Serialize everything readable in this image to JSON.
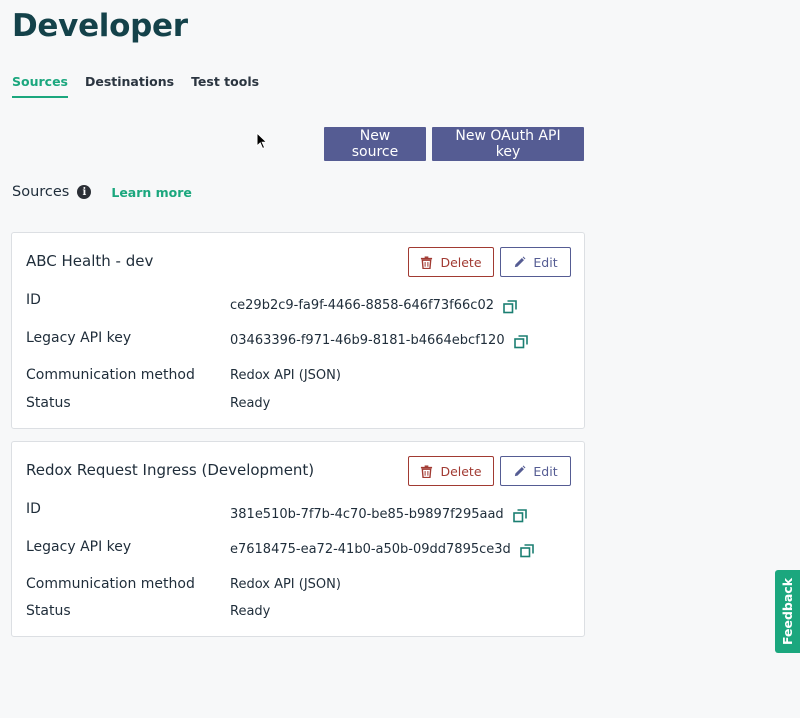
{
  "page": {
    "title": "Developer"
  },
  "tabs": [
    {
      "label": "Sources",
      "active": true
    },
    {
      "label": "Destinations",
      "active": false
    },
    {
      "label": "Test tools",
      "active": false
    }
  ],
  "actions": {
    "new_source": "New source",
    "new_oauth": "New OAuth API key"
  },
  "section": {
    "label": "Sources",
    "info_glyph": "i",
    "learn_more": "Learn more"
  },
  "labels": {
    "id": "ID",
    "legacy_api_key": "Legacy API key",
    "communication_method": "Communication method",
    "status": "Status",
    "delete": "Delete",
    "edit": "Edit"
  },
  "sources": [
    {
      "name": "ABC Health - dev",
      "id": "ce29b2c9-fa9f-4466-8858-646f73f66c02",
      "legacy_api_key": "03463396-f971-46b9-8181-b4664ebcf120",
      "communication_method": "Redox API (JSON)",
      "status": "Ready"
    },
    {
      "name": "Redox Request Ingress (Development)",
      "id": "381e510b-7f7b-4c70-be85-b9897f295aad",
      "legacy_api_key": "e7618475-ea72-41b0-a50b-09dd7895ce3d",
      "communication_method": "Redox API (JSON)",
      "status": "Ready"
    }
  ],
  "feedback": {
    "label": "Feedback"
  },
  "colors": {
    "title": "#14424a",
    "accent_green": "#1ba77e",
    "primary_button": "#555c93",
    "danger": "#a13a32"
  },
  "icons": [
    "info-icon",
    "trash-icon",
    "pencil-icon",
    "copy-icon",
    "cursor-icon"
  ]
}
